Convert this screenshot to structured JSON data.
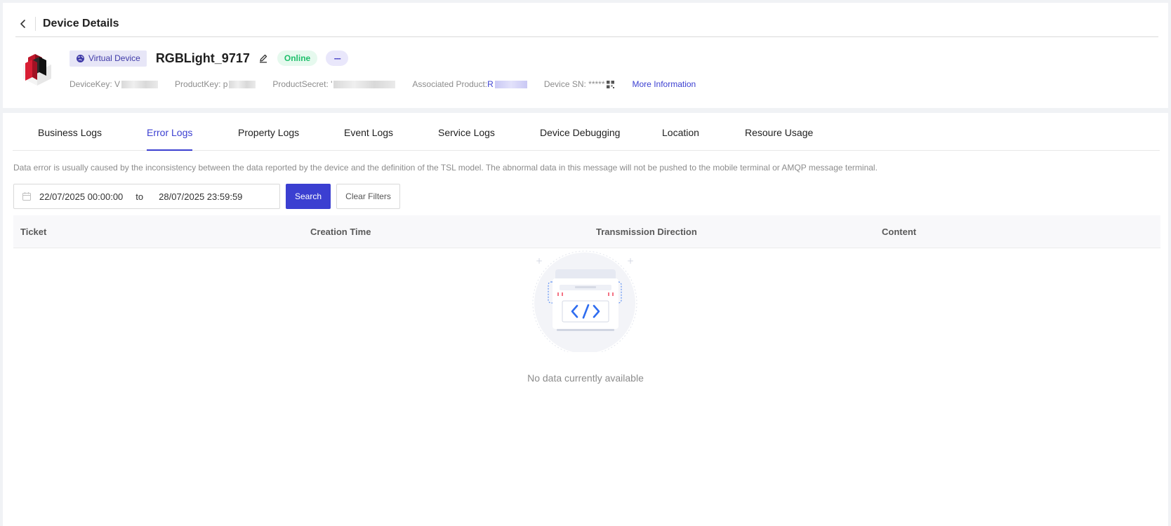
{
  "header": {
    "title": "Device Details",
    "badge_virtual": "Virtual Device",
    "device_name": "RGBLight_9717",
    "status": "Online",
    "more_badge": "---"
  },
  "meta": {
    "device_key_label": "DeviceKey: V",
    "product_key_label": "ProductKey: p",
    "product_secret_label": "ProductSecret: '",
    "associated_product_label": "Associated Product: ",
    "associated_product_value": "R",
    "device_sn_label": "Device SN: *****",
    "more_information": "More Information"
  },
  "tabs": [
    {
      "label": "Business Logs",
      "active": false
    },
    {
      "label": "Error Logs",
      "active": true
    },
    {
      "label": "Property Logs",
      "active": false
    },
    {
      "label": "Event Logs",
      "active": false
    },
    {
      "label": "Service Logs",
      "active": false
    },
    {
      "label": "Device Debugging",
      "active": false
    },
    {
      "label": "Location",
      "active": false
    },
    {
      "label": "Resoure Usage",
      "active": false
    }
  ],
  "notice": "Data error is usually caused by the inconsistency between the data reported by the device and the definition of the TSL model. The abnormal data in this message will not be pushed to the mobile terminal or AMQP message terminal.",
  "filters": {
    "start_date": "22/07/2025 00:00:00",
    "to_label": "to",
    "end_date": "28/07/2025 23:59:59",
    "search_label": "Search",
    "clear_label": "Clear Filters"
  },
  "table": {
    "columns": [
      "Ticket",
      "Creation Time",
      "Transmission Direction",
      "Content"
    ],
    "empty_text": "No data currently available"
  },
  "colors": {
    "accent": "#3b3fd1",
    "online": "#1fbf6b",
    "virtual_badge_bg": "#e7e6f7"
  },
  "icons": {
    "back": "chevron-left-icon",
    "virtual": "globe-icon",
    "edit": "pencil-icon",
    "qr": "qr-code-icon",
    "calendar": "calendar-icon",
    "empty": "code-box-icon"
  }
}
